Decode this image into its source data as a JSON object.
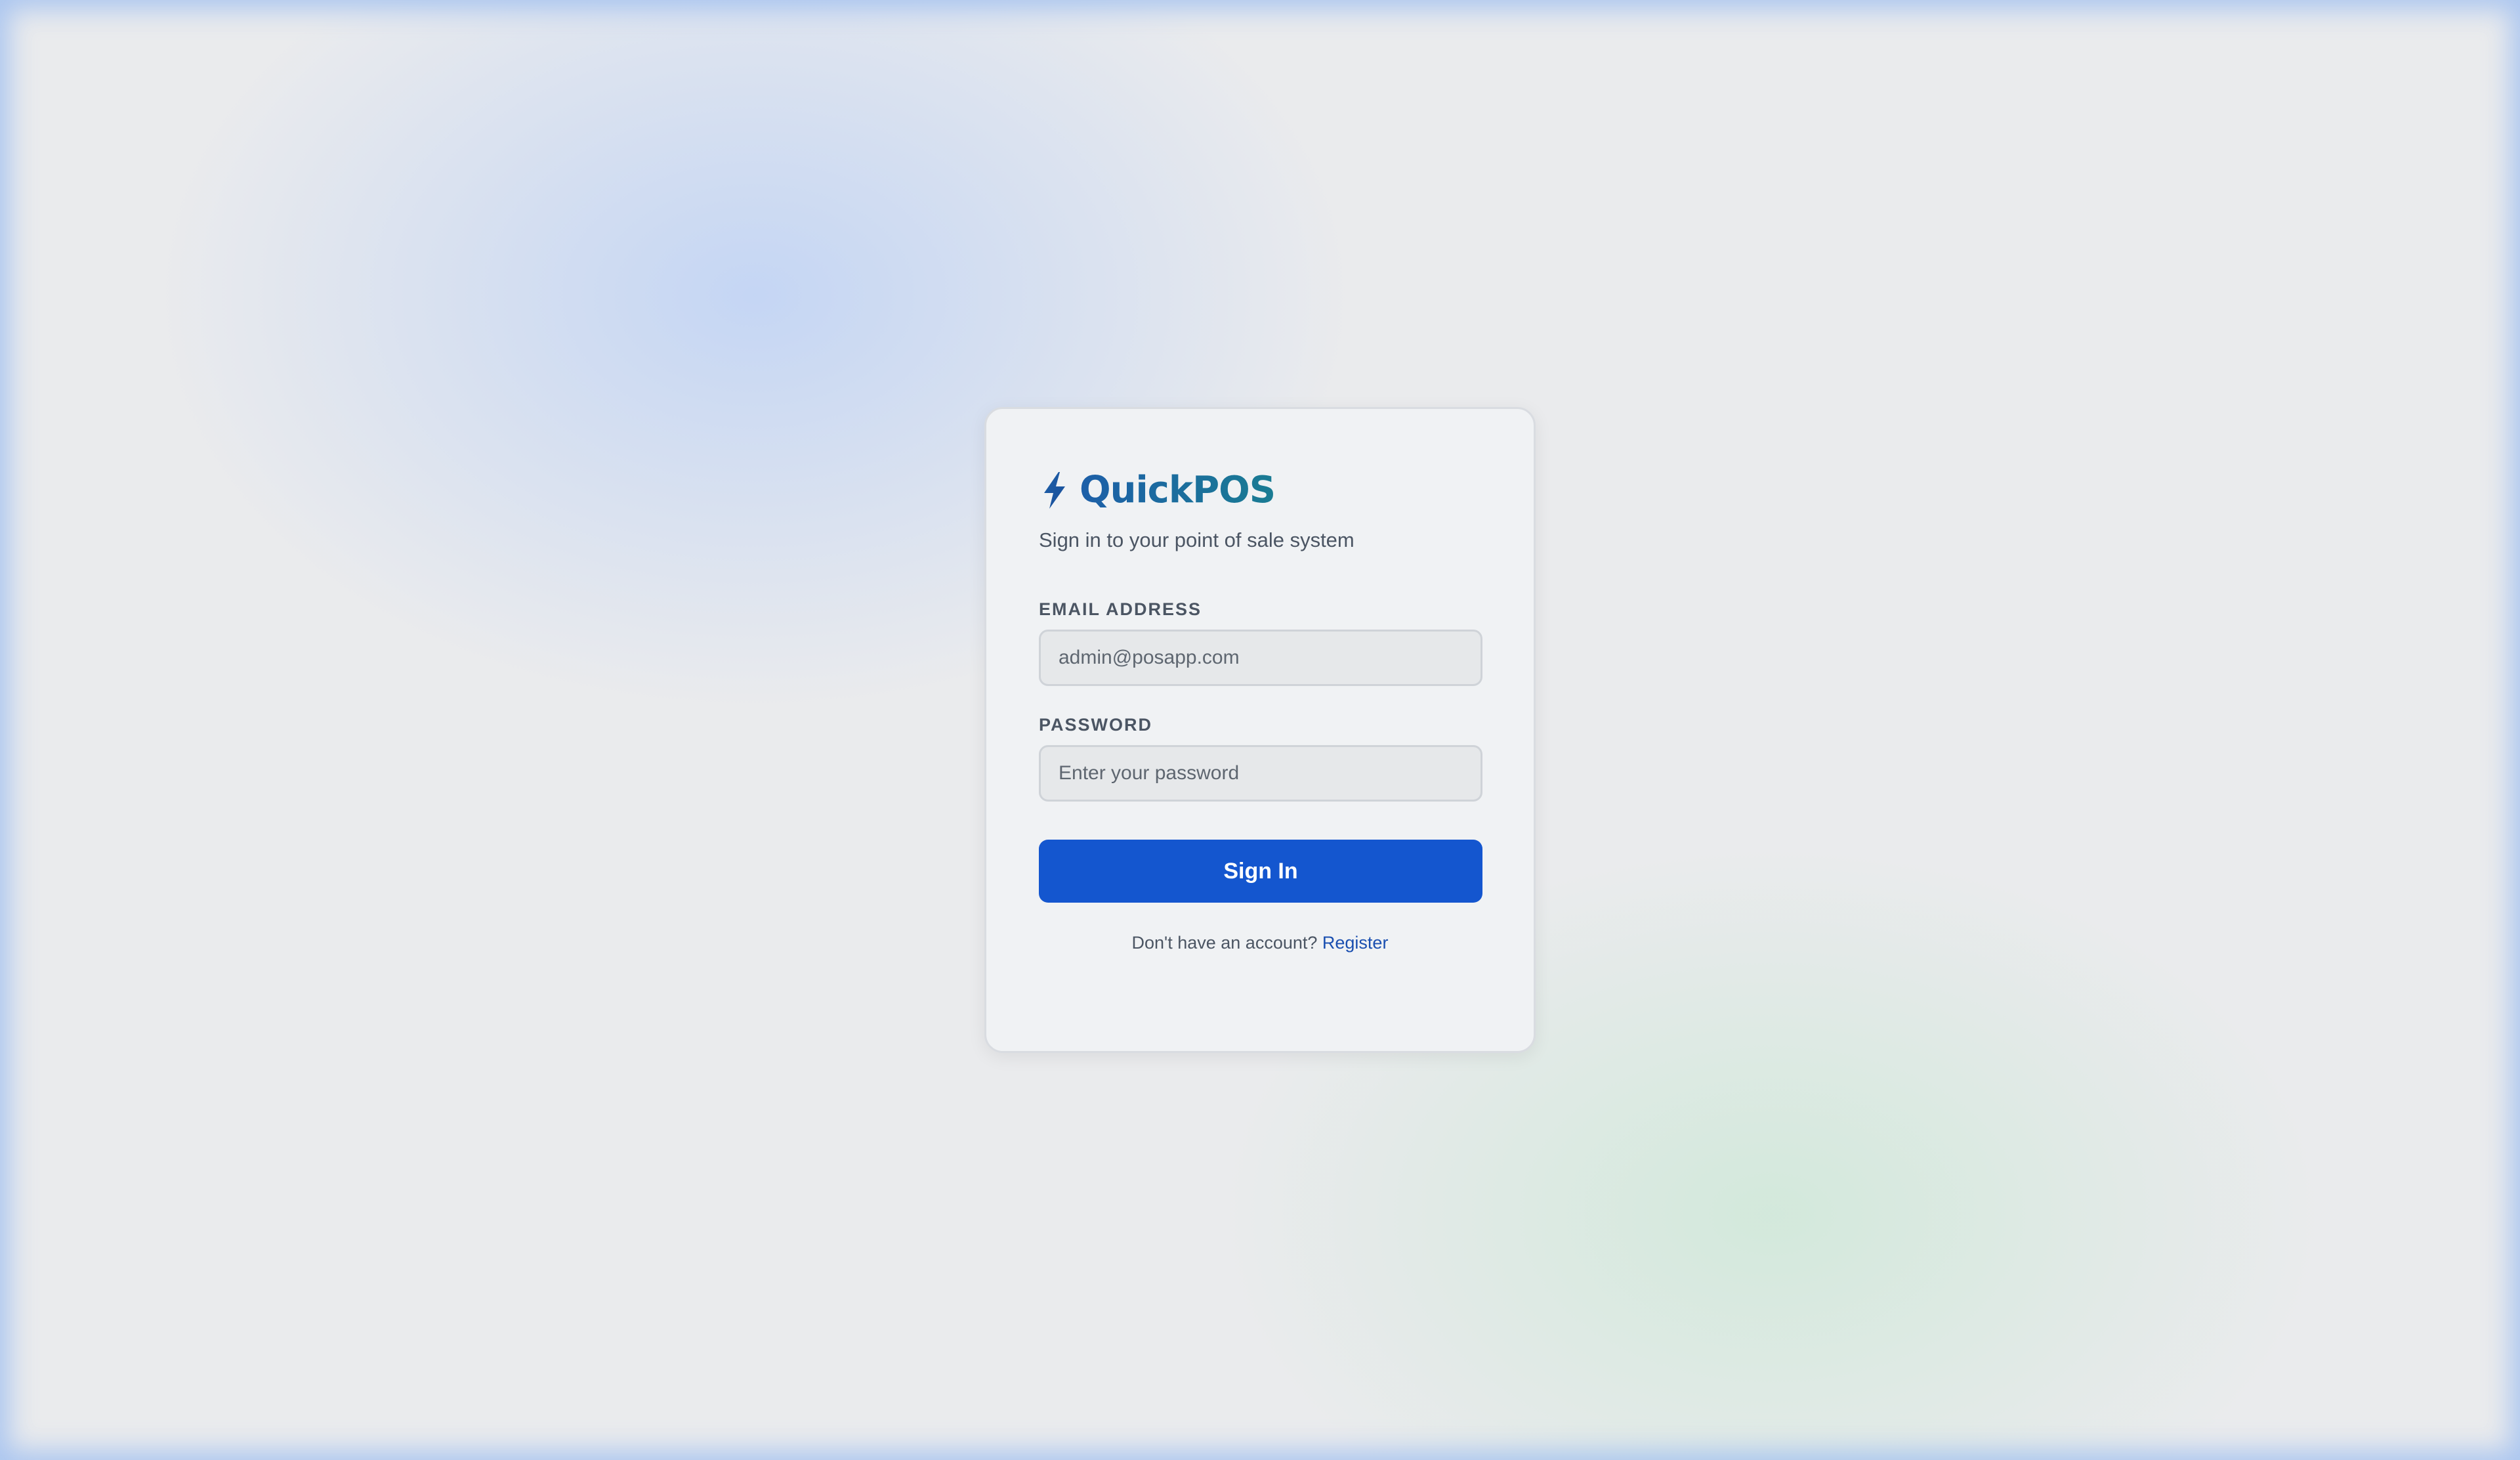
{
  "app": {
    "name": "QuickPOS",
    "subtitle": "Sign in to your point of sale system",
    "logo_icon": "lightning-bolt-icon",
    "accent_color": "#1456cf"
  },
  "form": {
    "email": {
      "label": "EMAIL ADDRESS",
      "value": "",
      "placeholder": "admin@posapp.com"
    },
    "password": {
      "label": "PASSWORD",
      "value": "",
      "placeholder": "Enter your password"
    },
    "submit_label": "Sign In"
  },
  "footer": {
    "prompt": "Don't have an account?",
    "link_label": "Register"
  }
}
